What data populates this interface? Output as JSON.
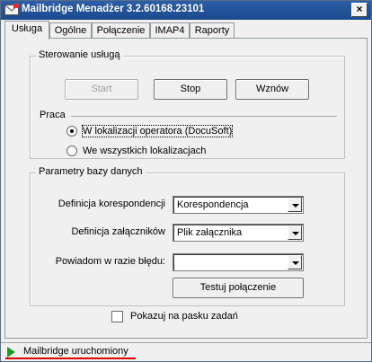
{
  "window": {
    "title": "Mailbridge Menadżer 3.2.60168.23101",
    "close_glyph": "×"
  },
  "tabs": [
    {
      "label": "Usługa",
      "active": true
    },
    {
      "label": "Ogólne",
      "active": false
    },
    {
      "label": "Połączenie",
      "active": false
    },
    {
      "label": "IMAP4",
      "active": false
    },
    {
      "label": "Raporty",
      "active": false
    }
  ],
  "service_control": {
    "title": "Sterowanie usługą",
    "start_label": "Start",
    "stop_label": "Stop",
    "resume_label": "Wznów",
    "start_enabled": false
  },
  "work": {
    "title": "Praca",
    "options": [
      {
        "label": "W lokalizacji operatora (DocuSoft)",
        "selected": true
      },
      {
        "label": "We wszystkich lokalizacjach",
        "selected": false
      }
    ]
  },
  "db_params": {
    "title": "Parametry bazy danych",
    "fields": [
      {
        "label": "Definicja korespondencji",
        "value": "Korespondencja"
      },
      {
        "label": "Definicja załączników",
        "value": "Plik załącznika"
      },
      {
        "label": "Powiadom w razie błędu:",
        "value": ""
      }
    ],
    "test_button_label": "Testuj połączenie"
  },
  "taskbar_checkbox": {
    "label": "Pokazuj na pasku zadań",
    "checked": false
  },
  "status": {
    "text": "Mailbridge uruchomiony",
    "icon": "play-icon",
    "icon_color": "#1aa020",
    "underline_color": "#e00000"
  },
  "colors": {
    "titlebar": "#1b4a8e",
    "window_bg": "#f0f0f0"
  }
}
